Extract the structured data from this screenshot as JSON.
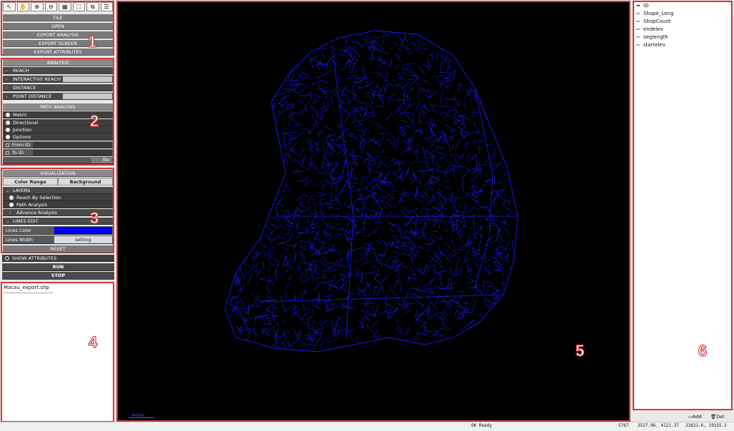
{
  "toolbar": {
    "tools": [
      {
        "icon": "pointer-icon",
        "glyph": "↖"
      },
      {
        "icon": "pan-hand-icon",
        "glyph": "✋"
      },
      {
        "icon": "zoom-in-icon",
        "glyph": "🔍"
      },
      {
        "icon": "zoom-out-icon",
        "glyph": "🔍"
      },
      {
        "icon": "grid-icon",
        "glyph": "▦"
      },
      {
        "icon": "full-extent-icon",
        "glyph": "⛶"
      },
      {
        "icon": "layer-icon",
        "glyph": "⧉"
      },
      {
        "icon": "list-icon",
        "glyph": "☰"
      }
    ]
  },
  "file_menu": {
    "file": "FILE",
    "open": "OPEN",
    "export_analysis": "EXPORT ANALYSIS",
    "export_screen": "EXPORT SCREEN",
    "export_attributes": "EXPORT ATTRIBUTES"
  },
  "analysis": {
    "header": "ANALYSIS",
    "reach": "REACH",
    "interactive_reach": "INTERACTIVE REACH",
    "distance": "DISTANCE",
    "point_distance": "POINT DISTANCE"
  },
  "path_analysis": {
    "header": "PATH ANALYSIS",
    "metric": "Metric",
    "directional": "Directional",
    "junction": "Junction",
    "options": "Options",
    "from_id": "From ID",
    "to_id": "To ID",
    "file_btn": "file"
  },
  "visualization": {
    "header": "VISUALIZATION",
    "color_range": "Color Range",
    "background": "Background",
    "layers": "LAYERS",
    "reach_by_selection": "Reach By Selection",
    "path_analysis": "Path Analysis",
    "advance_analysis": "Advance Analysis",
    "lines_edit": "LINES EDIT",
    "lines_color": "Lines Color",
    "lines_color_value": "#0000ee",
    "lines_width": "Lines Width",
    "setting": "setting",
    "reset": "RESET"
  },
  "controls": {
    "show_attributes": "SHOW ATTRIBUTES",
    "run": "RUN",
    "stop": "STOP"
  },
  "log": {
    "filename": "Macau_export.shp",
    "separator": "--------------------------------"
  },
  "map": {
    "scale": "445m"
  },
  "attributes": {
    "fields": [
      "ID",
      "Shape_Leng",
      "ShopCount",
      "endelev",
      "seglength",
      "startelev"
    ],
    "add": "Add",
    "del": "Del"
  },
  "status_bar": {
    "state": "OK  Ready",
    "count": "5767",
    "coord_a": "3527.96,  4121.37",
    "coord_b": "23621.6,  19155.2"
  },
  "labels": {
    "n1": "1",
    "n2": "2",
    "n3": "3",
    "n4": "4",
    "n5": "5",
    "n6": "6"
  },
  "colors": {
    "frame_red": "#d23a3a",
    "map_bg": "#000000",
    "network_blue": "#1a1aff"
  }
}
